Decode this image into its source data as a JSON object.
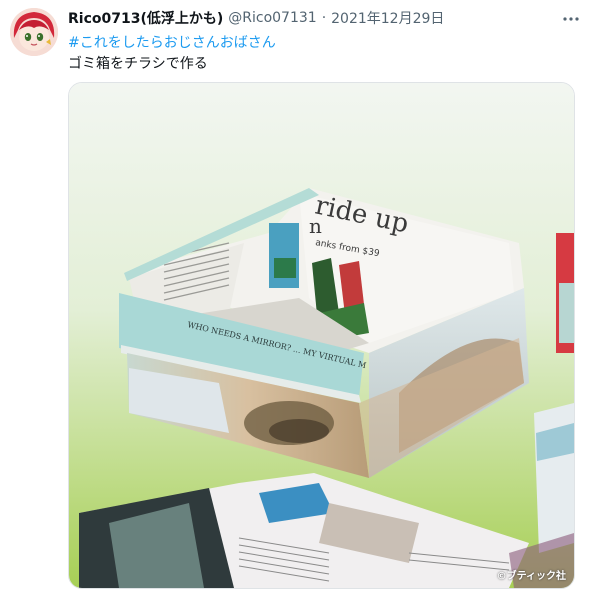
{
  "tweet": {
    "display_name": "Rico0713(低浮上かも)",
    "handle": "@Rico07131",
    "separator": "·",
    "date": "2021年12月29日",
    "more_icon": "more-horizontal-icon",
    "hashtag": "#これをしたらおじさんおばさん",
    "text": "ゴミ箱をチラシで作る"
  },
  "media": {
    "description_icon": "photo",
    "credit": "©ブティック社",
    "magazine_texts": {
      "headline": "ride up",
      "subline": "n",
      "price_line": "anks from $39",
      "band_text": "WHO NEEDS A MIRROR? ... MY VIRTUAL M"
    },
    "colors": {
      "background_top": "#f2f6f1",
      "background_bottom": "#a7cf55",
      "box_inner": "#eeeeea",
      "box_band": "#a9d8d6"
    }
  }
}
